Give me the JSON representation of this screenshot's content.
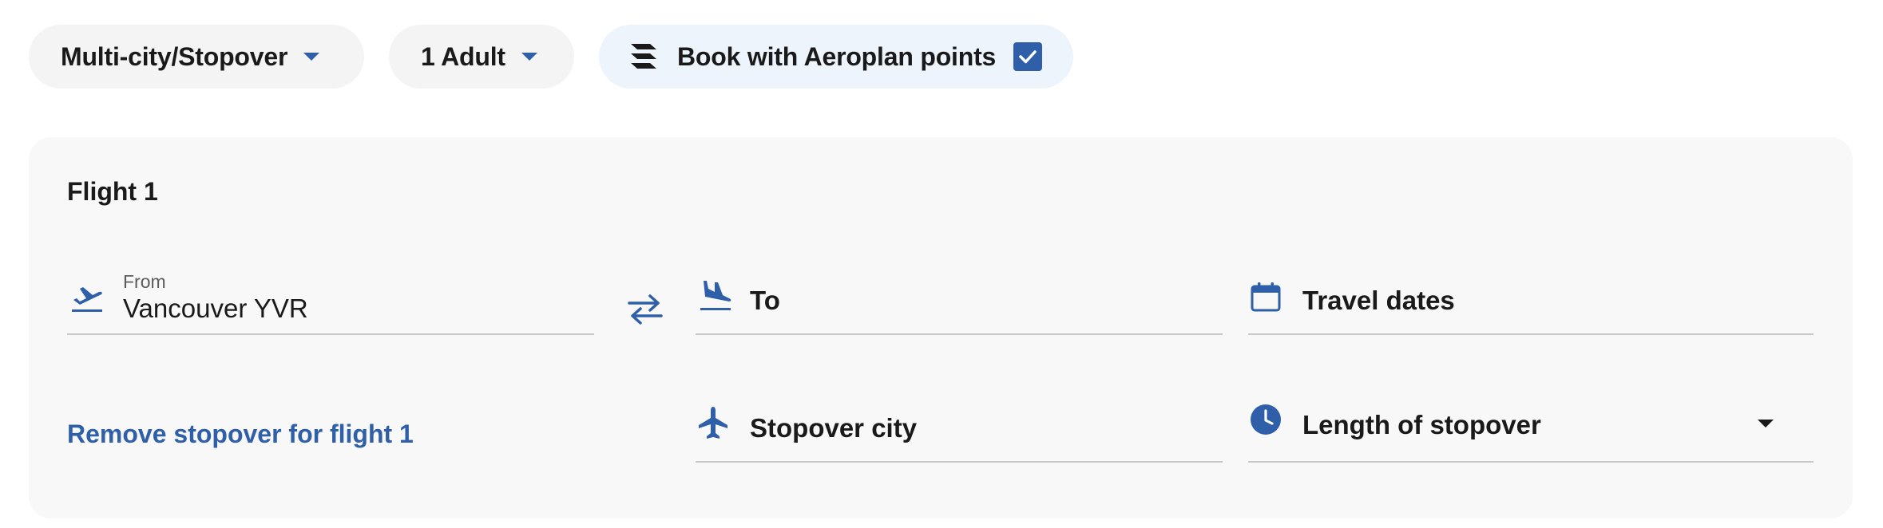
{
  "toolbar": {
    "trip_type": "Multi-city/Stopover",
    "passengers": "1 Adult",
    "points_label": "Book with Aeroplan points",
    "points_checked": true
  },
  "flight": {
    "title": "Flight 1",
    "from": {
      "label": "From",
      "value": "Vancouver YVR"
    },
    "to": {
      "placeholder": "To"
    },
    "travel_dates": {
      "placeholder": "Travel dates"
    },
    "stopover_city": {
      "placeholder": "Stopover city"
    },
    "stopover_length": {
      "placeholder": "Length of stopover"
    },
    "remove_stopover": "Remove stopover for flight 1"
  },
  "colors": {
    "accent": "#2f5fa8",
    "panel": "#f8f8f8",
    "pill": "#f4f4f4",
    "pill_highlight": "#eef4fb"
  },
  "icons": {
    "departure": "plane-departure-icon",
    "arrival": "plane-arrival-icon",
    "swap": "swap-arrows-icon",
    "calendar": "calendar-icon",
    "stopover": "plane-icon",
    "clock": "clock-icon",
    "points": "aeroplan-logo-icon"
  }
}
